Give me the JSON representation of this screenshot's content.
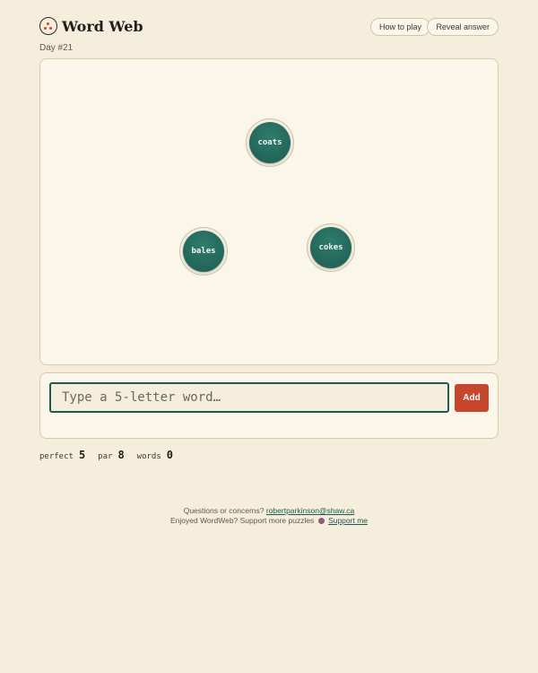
{
  "header": {
    "title": "Word Web",
    "how_to_play": "How to play",
    "reveal_answer": "Reveal answer"
  },
  "day_label": "Day #21",
  "board": {
    "nodes": [
      {
        "word": "coats"
      },
      {
        "word": "bales"
      },
      {
        "word": "cokes"
      }
    ]
  },
  "input": {
    "placeholder": "Type a 5-letter word…",
    "value": "",
    "add_label": "Add"
  },
  "stats": {
    "perfect_label": "perfect",
    "perfect_value": "5",
    "par_label": "par",
    "par_value": "8",
    "words_label": "words",
    "words_value": "0"
  },
  "footer": {
    "questions_text": "Questions or concerns?",
    "email": "robertparkinson@shaw.ca",
    "support_text": "Enjoyed WordWeb? Support more puzzles",
    "support_link": "Support me"
  },
  "colors": {
    "background": "#f5eedc",
    "node_green": "#246a5d",
    "add_button": "#c7472e"
  }
}
